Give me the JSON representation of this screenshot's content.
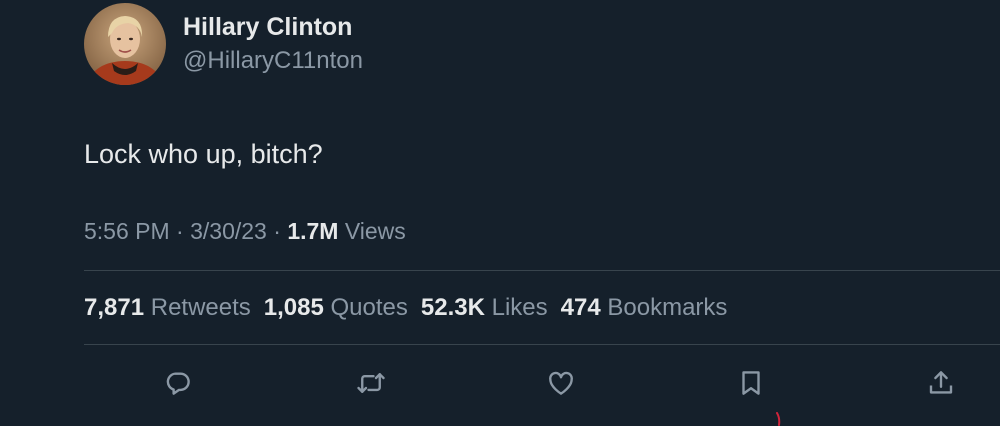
{
  "author": {
    "display_name": "Hillary Clinton",
    "handle": "@HillaryC11nton"
  },
  "tweet": {
    "text": "Lock who up, bitch?",
    "time": "5:56 PM",
    "date": "3/30/23",
    "separator": "·",
    "views_count": "1.7M",
    "views_label": "Views"
  },
  "stats": [
    {
      "count": "7,871",
      "label": "Retweets"
    },
    {
      "count": "1,085",
      "label": "Quotes"
    },
    {
      "count": "52.3K",
      "label": "Likes"
    },
    {
      "count": "474",
      "label": "Bookmarks"
    }
  ],
  "actions": [
    "reply-icon",
    "retweet-icon",
    "like-icon",
    "bookmark-icon",
    "share-icon"
  ],
  "colors": {
    "background": "#15202b",
    "text_primary": "#e7e9ea",
    "text_secondary": "#8b98a5",
    "divider": "#38444d"
  }
}
